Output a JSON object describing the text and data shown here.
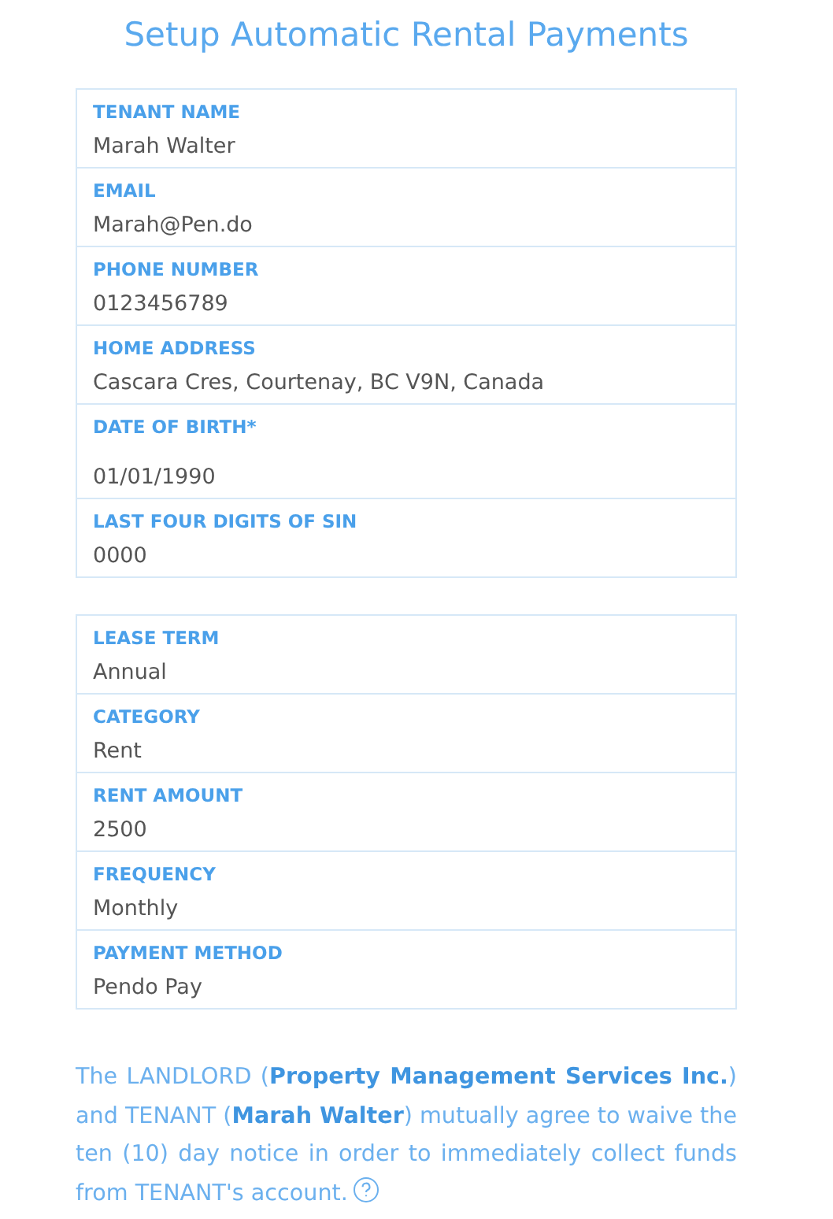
{
  "title": "Setup Automatic Rental Payments",
  "sections": [
    {
      "fields": [
        {
          "kind": "text",
          "label": "TENANT NAME",
          "value": "Marah Walter"
        },
        {
          "kind": "text",
          "label": "EMAIL",
          "value": "Marah@Pen.do"
        },
        {
          "kind": "text",
          "label": "PHONE NUMBER",
          "value": "0123456789"
        },
        {
          "kind": "text",
          "label": "HOME ADDRESS",
          "value": "Cascara Cres, Courtenay, BC V9N, Canada"
        },
        {
          "kind": "date",
          "label": "DATE OF BIRTH*",
          "value": "01/01/1990"
        },
        {
          "kind": "text",
          "label": "LAST FOUR DIGITS OF SIN",
          "value": "0000"
        }
      ]
    },
    {
      "fields": [
        {
          "kind": "text",
          "label": "LEASE TERM",
          "value": "Annual"
        },
        {
          "kind": "text",
          "label": "CATEGORY",
          "value": "Rent"
        },
        {
          "kind": "text",
          "label": "RENT AMOUNT",
          "value": "2500"
        },
        {
          "kind": "text",
          "label": "FREQUENCY",
          "value": "Monthly"
        },
        {
          "kind": "text",
          "label": "PAYMENT METHOD",
          "value": "Pendo Pay"
        }
      ]
    }
  ],
  "agreement": "The LANDLORD (**Property Management Services Inc.**) and TENANT (**Marah Walter**) mutually agree to waive the ten (10) day notice in order to immediately collect funds from TENANT's account."
}
